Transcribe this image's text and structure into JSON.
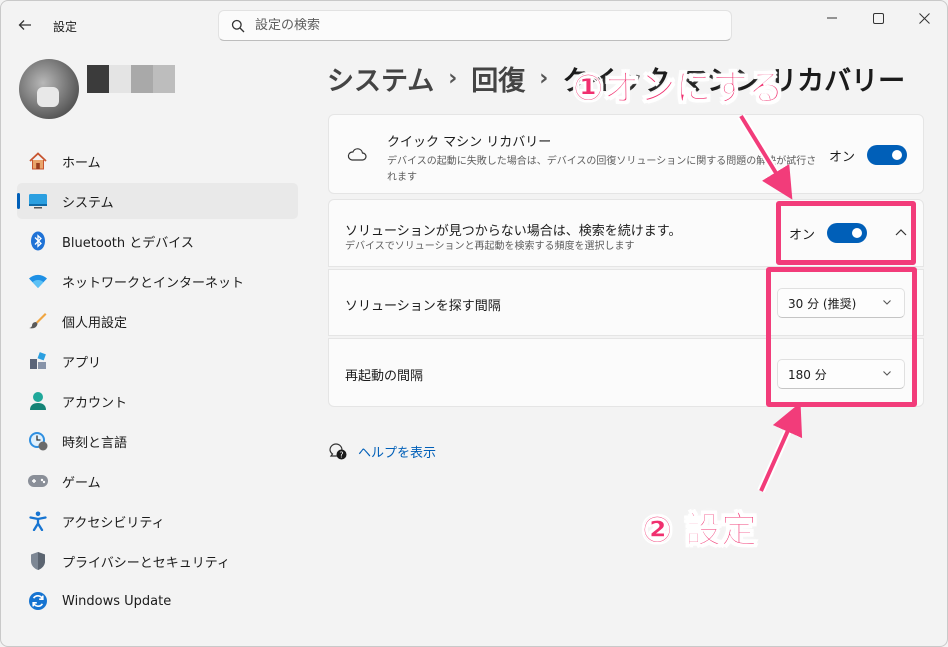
{
  "window": {
    "title": "設定",
    "search_placeholder": "設定の検索"
  },
  "sidebar": {
    "profile_name_colors": [
      "#3b3b3b",
      "#e4e4e4",
      "#a9a9a9",
      "#bdbdbd"
    ],
    "items": [
      {
        "label": "ホーム",
        "icon": "home-icon"
      },
      {
        "label": "システム",
        "icon": "system-icon"
      },
      {
        "label": "Bluetooth とデバイス",
        "icon": "bluetooth-icon"
      },
      {
        "label": "ネットワークとインターネット",
        "icon": "wifi-icon"
      },
      {
        "label": "個人用設定",
        "icon": "brush-icon"
      },
      {
        "label": "アプリ",
        "icon": "apps-icon"
      },
      {
        "label": "アカウント",
        "icon": "account-icon"
      },
      {
        "label": "時刻と言語",
        "icon": "time-language-icon"
      },
      {
        "label": "ゲーム",
        "icon": "gamepad-icon"
      },
      {
        "label": "アクセシビリティ",
        "icon": "accessibility-icon"
      },
      {
        "label": "プライバシーとセキュリティ",
        "icon": "shield-icon"
      },
      {
        "label": "Windows Update",
        "icon": "windows-update-icon"
      }
    ],
    "active_index": 1
  },
  "breadcrumb": {
    "items": [
      "システム",
      "回復",
      "クイック マシン リカバリー"
    ],
    "separator": "›"
  },
  "qmr_card": {
    "title": "クイック マシン リカバリー",
    "description": "デバイスの起動に失敗した場合は、デバイスの回復ソリューションに関する問題の解決が試行されます",
    "toggle_label": "オン",
    "toggle_on": true
  },
  "continue_card": {
    "title": "ソリューションが見つからない場合は、検索を続けます。",
    "description": "デバイスでソリューションと再起動を検索する頻度を選択します",
    "toggle_label": "オン",
    "toggle_on": true
  },
  "interval_card": {
    "title": "ソリューションを探す間隔",
    "selected": "30 分 (推奨)"
  },
  "restart_card": {
    "title": "再起動の間隔",
    "selected": "180 分"
  },
  "help": {
    "label": "ヘルプを表示"
  },
  "annotations": {
    "step1": "①オンにする",
    "step2": "② 設定",
    "color": "#f23c7a"
  }
}
